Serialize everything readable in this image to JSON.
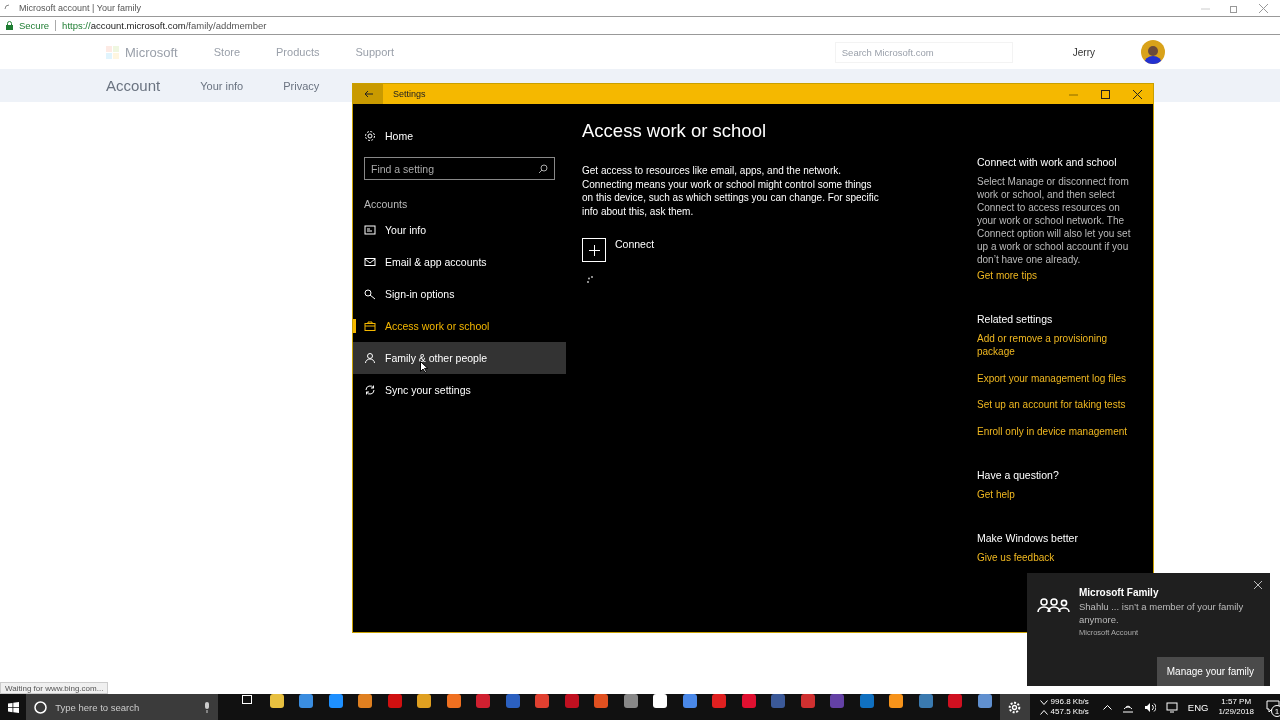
{
  "browser": {
    "tab_title": "Microsoft account | Your family",
    "security": "Secure",
    "url_scheme": "https://",
    "url_host": "account.microsoft.com",
    "url_path": "/family/addmember",
    "status": "Waiting for www.bing.com..."
  },
  "site": {
    "logo": "Microsoft",
    "nav": [
      "Store",
      "Products",
      "Support"
    ],
    "search_placeholder": "Search Microsoft.com",
    "user": "Jerry",
    "section": "Account",
    "tabs": [
      "Your info",
      "Privacy"
    ]
  },
  "settings": {
    "title": "Settings",
    "home": "Home",
    "search_placeholder": "Find a setting",
    "group": "Accounts",
    "nav": [
      {
        "label": "Your info",
        "selected": false,
        "hovered": false
      },
      {
        "label": "Email & app accounts",
        "selected": false,
        "hovered": false
      },
      {
        "label": "Sign-in options",
        "selected": false,
        "hovered": false
      },
      {
        "label": "Access work or school",
        "selected": true,
        "hovered": false
      },
      {
        "label": "Family & other people",
        "selected": false,
        "hovered": true
      },
      {
        "label": "Sync your settings",
        "selected": false,
        "hovered": false
      }
    ],
    "heading": "Access work or school",
    "description": "Get access to resources like email, apps, and the network. Connecting means your work or school might control some things on this device, such as which settings you can change. For specific info about this, ask them.",
    "connect": "Connect",
    "aside": [
      {
        "heading": "Connect with work and school",
        "text": "Select Manage or disconnect from work or school, and then select Connect to access resources on your work or school network. The Connect option will also let you set up a work or school account if you don’t have one already.",
        "links": [
          "Get more tips"
        ]
      },
      {
        "heading": "Related settings",
        "links": [
          "Add or remove a provisioning package",
          "Export your management log files",
          "Set up an account for taking tests",
          "Enroll only in device management"
        ]
      },
      {
        "heading": "Have a question?",
        "links": [
          "Get help"
        ]
      },
      {
        "heading": "Make Windows better",
        "links": [
          "Give us feedback"
        ]
      }
    ]
  },
  "toast": {
    "title": "Microsoft Family",
    "message": "Shahlu ... isn’t a member of your family anymore.",
    "source": "Microsoft Account",
    "button": "Manage your family"
  },
  "taskbar": {
    "search_placeholder": "Type here to search",
    "net_down": "996.8 Kb/s",
    "net_up": "457.5 Kb/s",
    "language": "ENG",
    "time": "1:57 PM",
    "date": "1/29/2018",
    "notifications": "1"
  }
}
